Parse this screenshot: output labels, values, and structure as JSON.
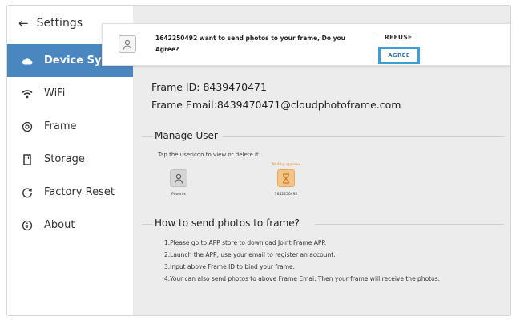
{
  "sidebar": {
    "header": {
      "label": "Settings"
    },
    "items": [
      {
        "label": "Device Sync",
        "icon": "cloud-icon",
        "active": true
      },
      {
        "label": "WiFi",
        "icon": "wifi-icon"
      },
      {
        "label": "Frame",
        "icon": "frame-gear-icon"
      },
      {
        "label": "Storage",
        "icon": "storage-icon"
      },
      {
        "label": "Factory Reset",
        "icon": "reset-icon"
      },
      {
        "label": "About",
        "icon": "info-icon"
      }
    ]
  },
  "popup": {
    "message": "1642250492 want to send photos to your frame, Do you Agree?",
    "refuse_label": "REFUSE",
    "agree_label": "AGREE",
    "agree_border_color": "#3aa0d6"
  },
  "device": {
    "frame_id_label": "Frame ID:",
    "frame_id": "8439470471",
    "frame_email_label": "Frame Email:",
    "frame_email": "8439470471@cloudphotoframe.com"
  },
  "manage_user": {
    "title": "Manage User",
    "hint": "Tap the usericon to view or delete it.",
    "users": [
      {
        "name": "Phoenix",
        "status": "",
        "icon": "user-icon"
      },
      {
        "name": "1642250492",
        "status": "Waiting approve",
        "icon": "hourglass-icon"
      }
    ]
  },
  "howto": {
    "title": "How to send photos to frame?",
    "steps": [
      "1.Please go to APP store to download Joint Frame APP.",
      "2.Launch the APP, use your email to register an account.",
      "3.Input above Frame ID to bind your frame.",
      "4.Your can also send photos to above Frame Emai. Then your frame will receive the photos."
    ]
  },
  "colors": {
    "accent": "#4a86c0",
    "pending": "#e08a2a",
    "content_bg": "#ececec"
  }
}
